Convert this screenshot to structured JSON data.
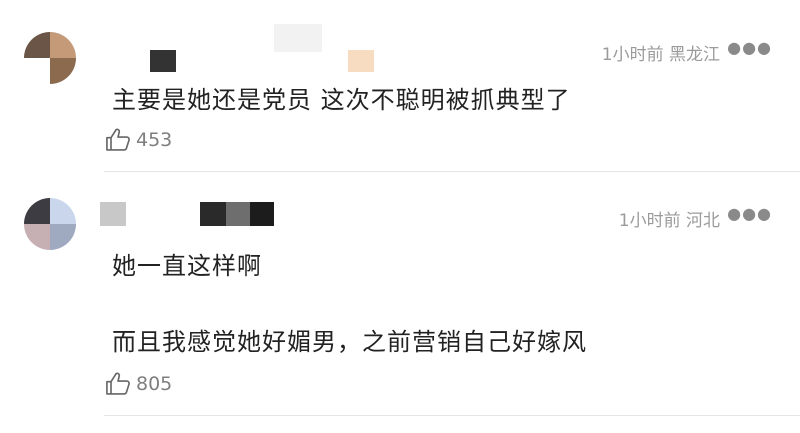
{
  "comments": [
    {
      "meta": "1小时前 黑龙江",
      "more_icon": "more-dots-icon",
      "lines": [
        "主要是她还是党员  这次不聪明被抓典型了"
      ],
      "likes": "453",
      "like_icon": "thumb-up-icon"
    },
    {
      "meta": "1小时前 河北",
      "more_icon": "more-dots-icon",
      "lines": [
        "她一直这样啊",
        "而且我感觉她好媚男，之前营销自己好嫁风"
      ],
      "likes": "805",
      "like_icon": "thumb-up-icon"
    }
  ],
  "colors": {
    "meta_gray": "#9b9b9b",
    "text": "#222222",
    "divider": "#e6e6e6"
  }
}
